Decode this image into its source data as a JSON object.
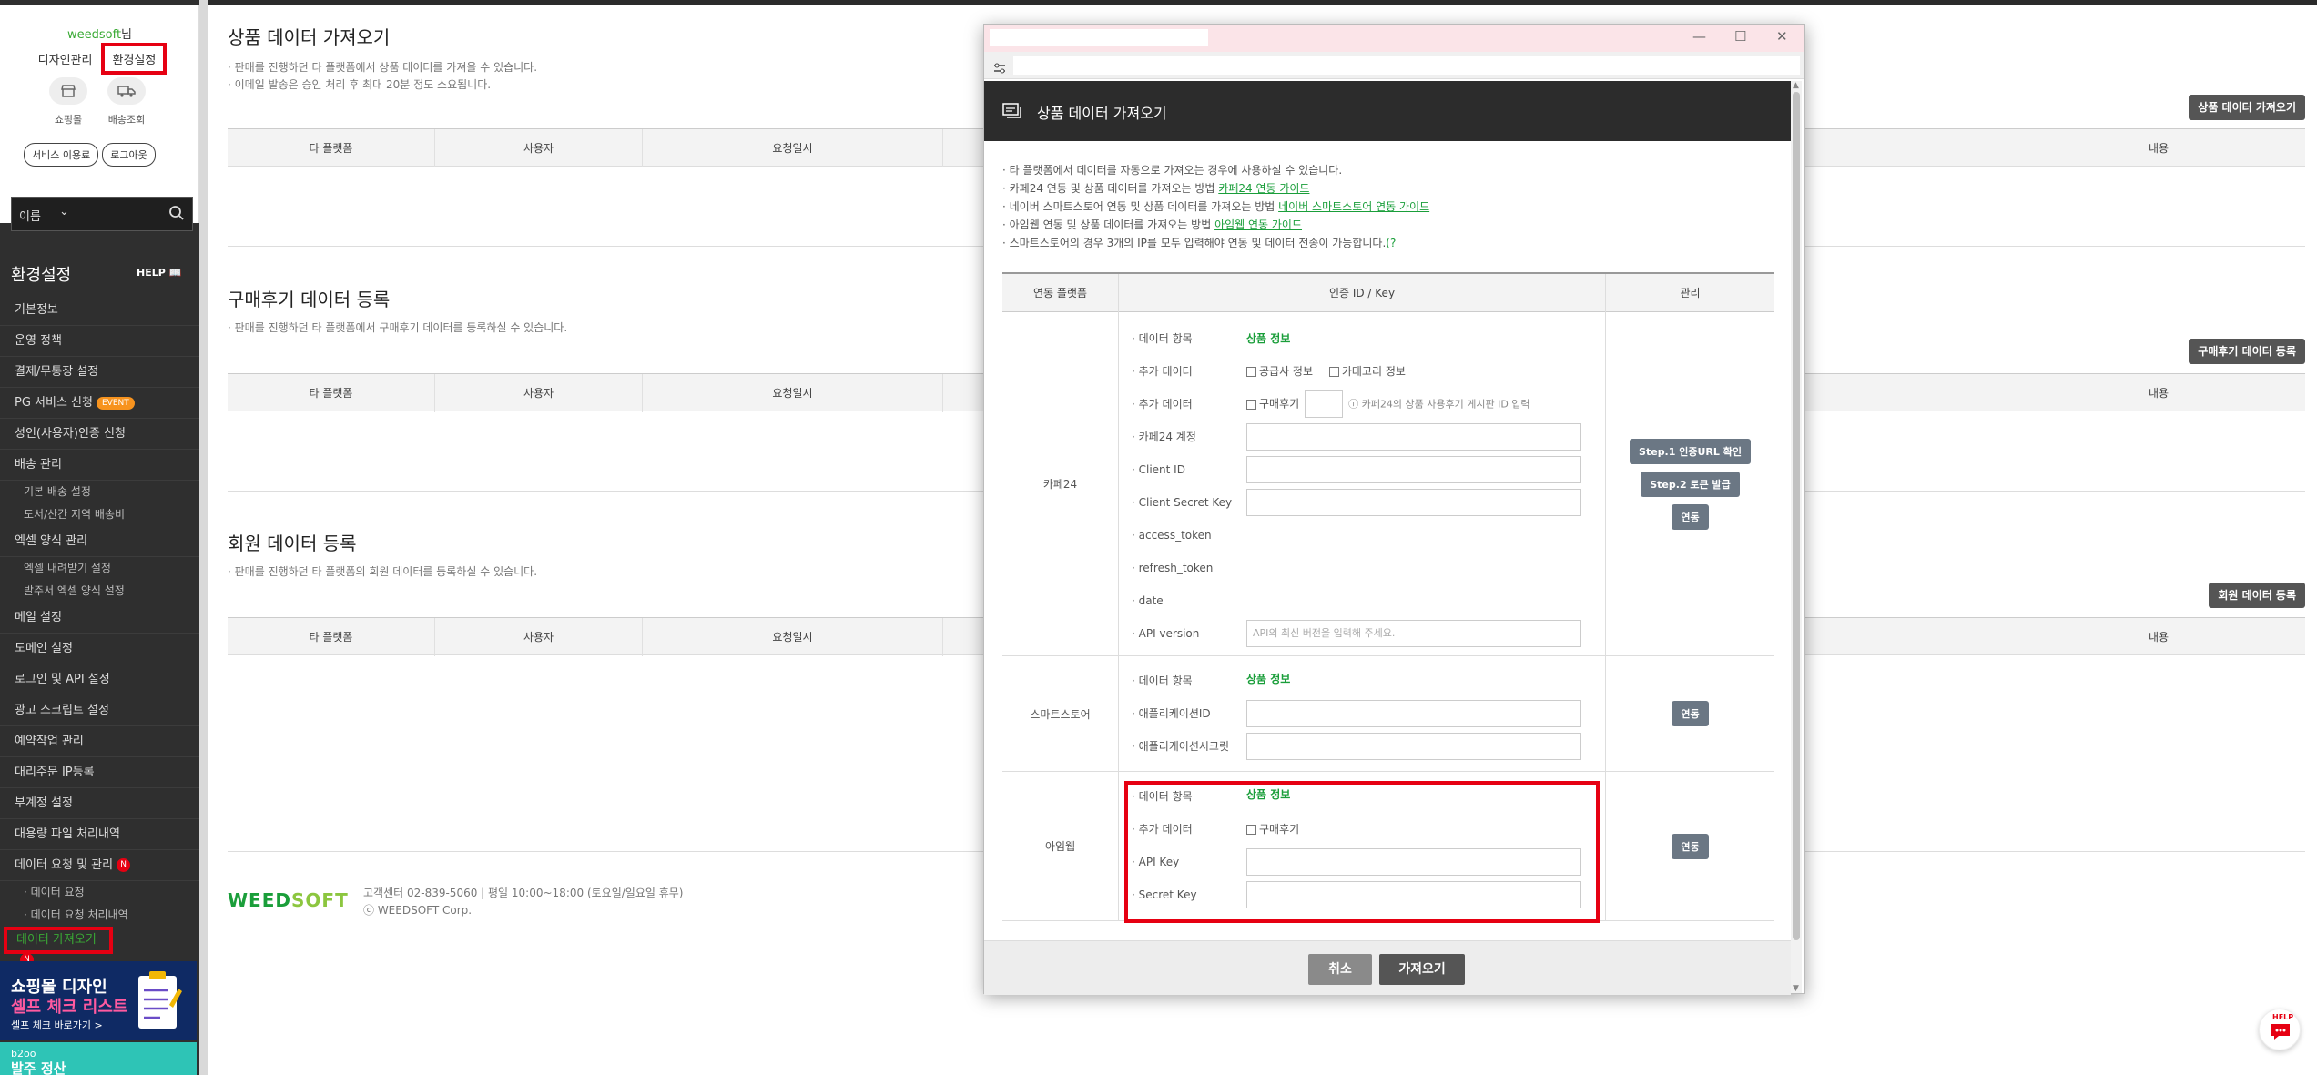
{
  "sidebar": {
    "user_name": "weedsoft",
    "user_suffix": "님",
    "link_design": "디자인관리",
    "link_settings": "환경설정",
    "icon_mall": "쇼핑몰",
    "icon_delivery": "배송조회",
    "pill_service": "서비스 이용료",
    "pill_logout": "로그아웃",
    "search_select": "이름",
    "section_title": "환경설정",
    "help": "HELP",
    "menu": [
      {
        "label": "기본정보",
        "type": "item"
      },
      {
        "label": "운영 정책",
        "type": "item"
      },
      {
        "label": "결제/무통장 설정",
        "type": "item"
      },
      {
        "label": "PG 서비스 신청",
        "type": "item",
        "badge": "EVENT"
      },
      {
        "label": "성인(사용자)인증 신청",
        "type": "item"
      },
      {
        "label": "배송 관리",
        "type": "item"
      },
      {
        "label": "기본 배송 설정",
        "type": "sub"
      },
      {
        "label": "도서/산간 지역 배송비",
        "type": "sub"
      },
      {
        "label": "엑셀 양식 관리",
        "type": "item"
      },
      {
        "label": "엑셀 내려받기 설정",
        "type": "sub"
      },
      {
        "label": "발주서 엑셀 양식 설정",
        "type": "sub"
      },
      {
        "label": "메일 설정",
        "type": "item"
      },
      {
        "label": "도메인 설정",
        "type": "item"
      },
      {
        "label": "로그인 및 API 설정",
        "type": "item"
      },
      {
        "label": "광고 스크립트 설정",
        "type": "item"
      },
      {
        "label": "예약작업 관리",
        "type": "item"
      },
      {
        "label": "대리주문 IP등록",
        "type": "item"
      },
      {
        "label": "부계정 설정",
        "type": "item"
      },
      {
        "label": "대용량 파일 처리내역",
        "type": "item"
      },
      {
        "label": "데이터 요청 및 관리",
        "type": "item",
        "badge": "N"
      },
      {
        "label": "· 데이터 요청",
        "type": "sub"
      },
      {
        "label": "· 데이터 요청 처리내역",
        "type": "sub"
      }
    ],
    "active_item": "데이터 가져오기",
    "active_badge": "N",
    "banner1_line1": "쇼핑몰 디자인",
    "banner1_line2": "셀프 체크 리스트",
    "banner1_line3": "셀프 체크 바로가기 >",
    "banner2_line1": "b2oo",
    "banner2_line2": "발주 정산"
  },
  "main": {
    "sections": [
      {
        "title": "상품 데이터 가져오기",
        "desc": [
          "· 판매를 진행하던 타 플랫폼에서 상품 데이터를 가져올 수 있습니다.",
          "· 이메일 발송은 승인 처리 후 최대 20분 정도 소요됩니다."
        ],
        "button": "상품 데이터 가져오기"
      },
      {
        "title": "구매후기 데이터 등록",
        "desc": [
          "· 판매를 진행하던 타 플랫폼에서 구매후기 데이터를 등록하실 수 있습니다."
        ],
        "button": "구매후기 데이터 등록"
      },
      {
        "title": "회원 데이터 등록",
        "desc": [
          "· 판매를 진행하던 타 플랫폼의 회원 데이터를 등록하실 수 있습니다."
        ],
        "button": "회원 데이터 등록"
      }
    ],
    "columns": [
      "타 플랫폼",
      "사용자",
      "요청일시",
      "내용"
    ],
    "footer_logo_a": "WEED",
    "footer_logo_b": "SOFT",
    "footer_line1": "고객센터 02-839-5060   |   평일 10:00~18:00 (토요일/일요일 휴무)",
    "footer_line2": "ⓒ WEEDSOFT Corp.",
    "help_fab": "HELP"
  },
  "popup": {
    "title": "상품 데이터 가져오기",
    "notes": [
      {
        "text": "· 타 플랫폼에서 데이터를 자동으로 가져오는 경우에 사용하실 수 있습니다.",
        "link": ""
      },
      {
        "text": "· 카페24 연동 및 상품 데이터를 가져오는 방법 ",
        "link": "카페24 연동 가이드"
      },
      {
        "text": "· 네이버 스마트스토어 연동 및 상품 데이터를 가져오는 방법 ",
        "link": "네이버 스마트스토어 연동 가이드"
      },
      {
        "text": "· 아임웹 연동 및 상품 데이터를 가져오는 방법 ",
        "link": "아임웹 연동 가이드"
      },
      {
        "text": "· 스마트스토어의 경우 3개의 IP를 모두 입력해야 연동 및 데이터 전송이 가능합니다.",
        "link": ""
      }
    ],
    "table_headers": [
      "연동 플랫폼",
      "인증 ID / Key",
      "관리"
    ],
    "cafe24": {
      "platform": "카페24",
      "data_label": "· 데이터 항목",
      "data_value": "상품 정보",
      "extra_label": "· 추가 데이터",
      "extra_opt1": "공급사 정보",
      "extra_opt2": "카테고리 정보",
      "extra2_label": "· 추가 데이터",
      "extra2_opt": "구매후기",
      "extra2_hint": "ⓘ 카페24의 상품 사용후기 게시판 ID 입력",
      "account_label": "· 카페24 계정",
      "client_id_label": "· Client ID",
      "client_secret_label": "· Client Secret Key",
      "access_token_label": "· access_token",
      "refresh_token_label": "· refresh_token",
      "date_label": "· date",
      "api_version_label": "· API version",
      "api_version_placeholder": "API의 최신 버전을 입력해 주세요.",
      "btn_step1": "Step.1 인증URL 확인",
      "btn_step2": "Step.2 토큰 발급",
      "btn_link": "연동"
    },
    "smartstore": {
      "platform": "스마트스토어",
      "data_label": "· 데이터 항목",
      "data_value": "상품 정보",
      "app_id_label": "· 애플리케이션ID",
      "app_secret_label": "· 애플리케이션시크릿",
      "btn_link": "연동"
    },
    "imweb": {
      "platform": "아임웹",
      "data_label": "· 데이터 항목",
      "data_value": "상품 정보",
      "extra_label": "· 추가 데이터",
      "extra_opt": "구매후기",
      "api_key_label": "· API Key",
      "secret_key_label": "· Secret Key",
      "btn_link": "연동"
    },
    "btn_cancel": "취소",
    "btn_import": "가져오기"
  },
  "colors": {
    "accent_green": "#1a9e3a",
    "highlight_red": "#e60012",
    "sidebar_bg": "#2f2f2f",
    "popup_header": "#2c2c2c"
  }
}
